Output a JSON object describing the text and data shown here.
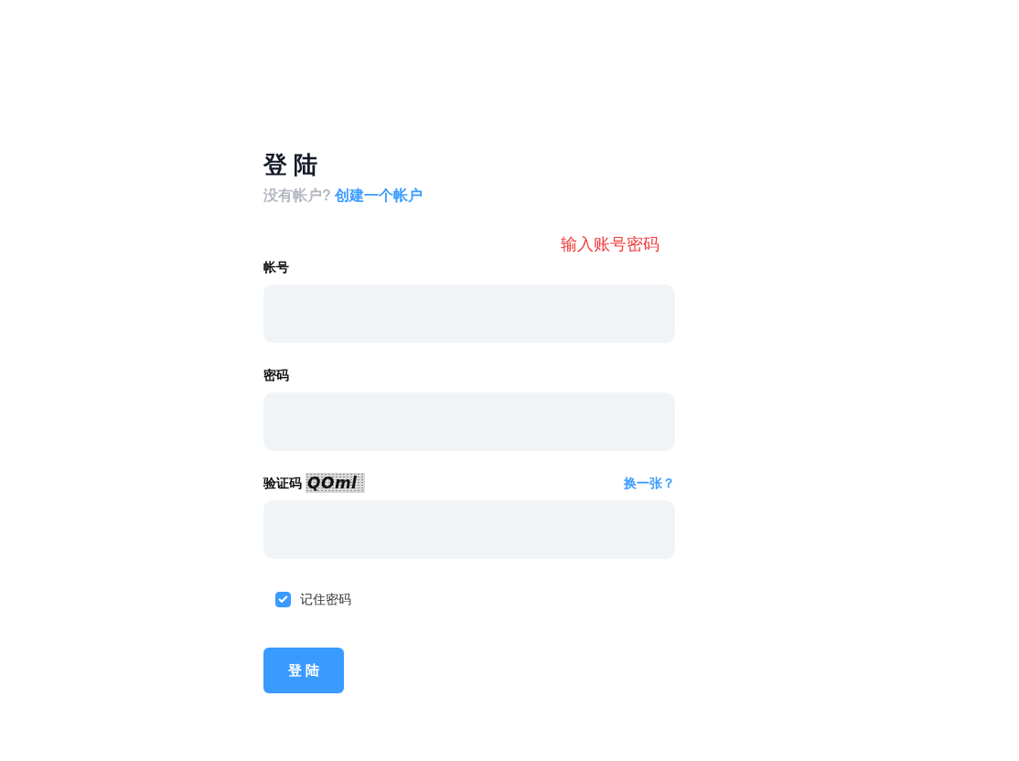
{
  "heading": "登 陆",
  "signup_prompt": {
    "text": "没有帐户?",
    "link": "创建一个帐户"
  },
  "hint": "输入账号密码",
  "fields": [
    {
      "kind": "text",
      "label": "帐号"
    },
    {
      "kind": "password",
      "label": "密码"
    },
    {
      "kind": "captcha",
      "label": "验证码",
      "captcha_text": "QOml",
      "refresh_link": "换一张？"
    }
  ],
  "remember": {
    "label": "记住密码",
    "checked": true
  },
  "submit_button": "登 陆"
}
